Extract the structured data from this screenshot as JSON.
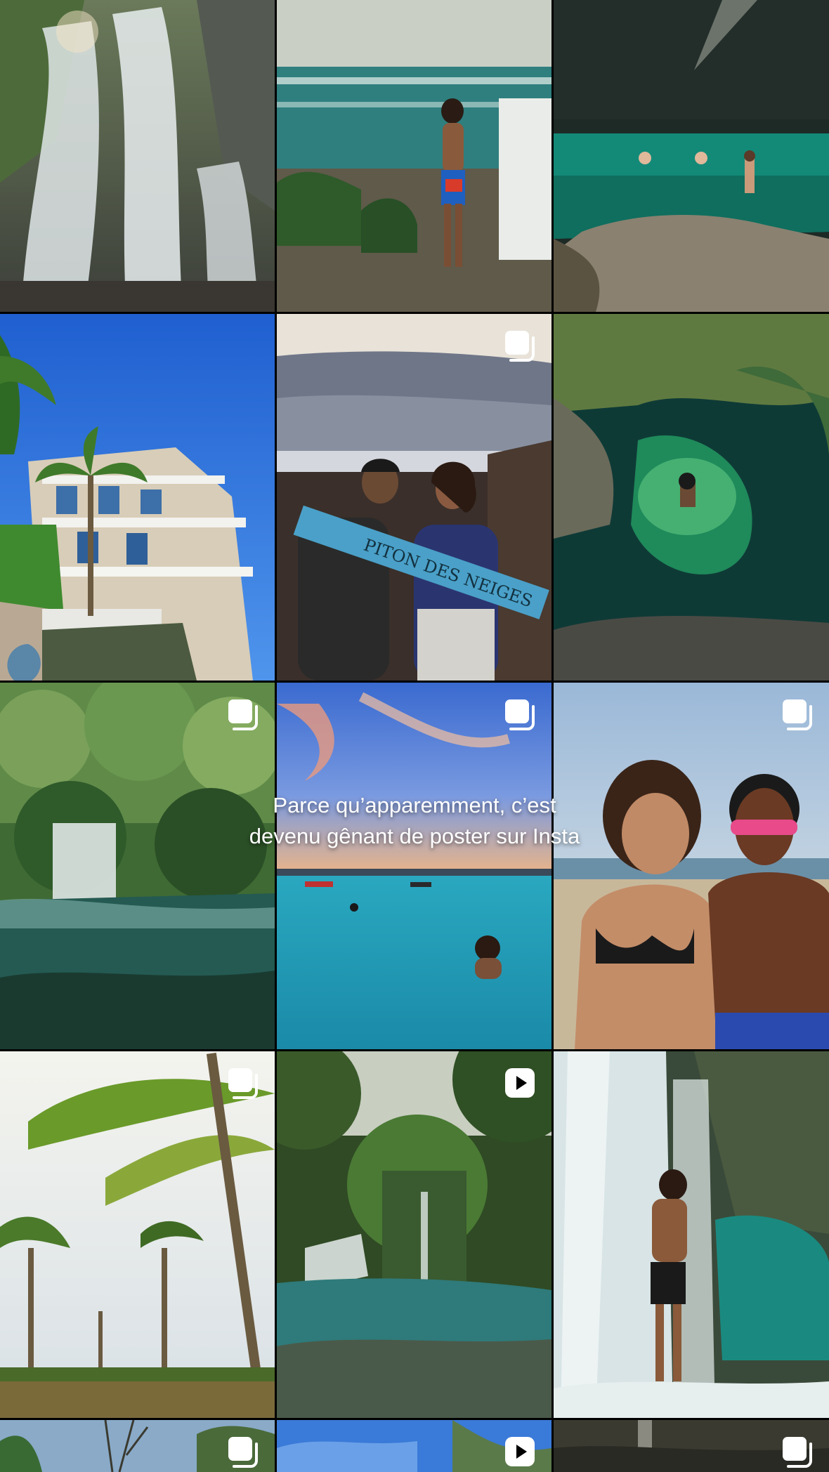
{
  "overlay": {
    "line1": "Parce qu’apparemment, c’est",
    "line2": "devenu gênant de poster sur Insta"
  },
  "tiles": [
    {
      "id": "waterfall-cliff",
      "badge": "none"
    },
    {
      "id": "boy-ocean-view",
      "badge": "none"
    },
    {
      "id": "cave-pool-swimmers",
      "badge": "none"
    },
    {
      "id": "colonial-mansion-palms",
      "badge": "none"
    },
    {
      "id": "piton-des-neiges-couple",
      "badge": "carousel-icon",
      "sign_text": "PITON DES NEIGES"
    },
    {
      "id": "lagoon-swimmer",
      "badge": "none"
    },
    {
      "id": "jungle-waterfall-pool",
      "badge": "carousel-icon"
    },
    {
      "id": "sunset-sea-swimmers",
      "badge": "carousel-icon"
    },
    {
      "id": "couple-beach-selfie",
      "badge": "carousel-icon"
    },
    {
      "id": "palm-trees-sunlight",
      "badge": "carousel-icon"
    },
    {
      "id": "forest-river-waterfall",
      "badge": "reel-icon"
    },
    {
      "id": "man-under-waterfall",
      "badge": "none"
    },
    {
      "id": "partial-tree-tile",
      "badge": "carousel-icon"
    },
    {
      "id": "partial-sky-tile",
      "badge": "reel-icon"
    },
    {
      "id": "partial-dark-tile",
      "badge": "carousel-icon"
    }
  ],
  "colors": {
    "divider": "#0b0b0b",
    "badge": "#ffffff"
  }
}
